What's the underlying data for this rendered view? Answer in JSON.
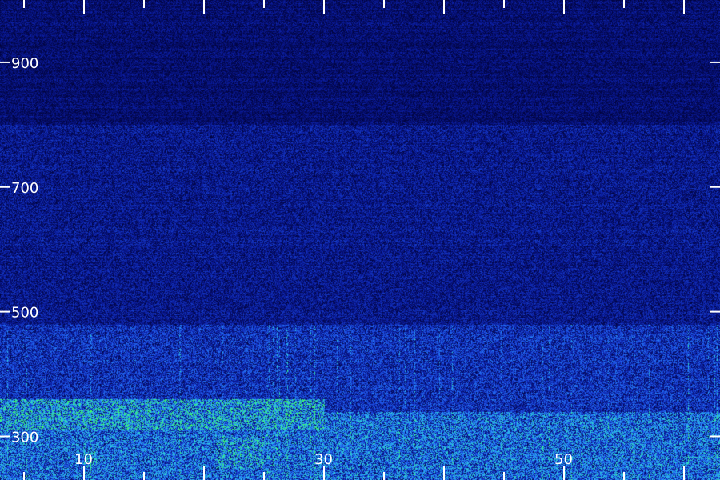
{
  "chart_data": {
    "type": "heatmap",
    "title": "",
    "xlabel": "",
    "ylabel": "",
    "xlim": [
      3,
      63
    ],
    "ylim": [
      230,
      1000
    ],
    "x_ticks": {
      "minor_step": 5,
      "labeled": [
        "10",
        "30",
        "50"
      ],
      "labeled_values": [
        10,
        30,
        50
      ]
    },
    "y_ticks": {
      "values": [
        300,
        500,
        700,
        900
      ],
      "labels": [
        "300",
        "500",
        "700",
        "900"
      ]
    },
    "colormap": [
      "#000030",
      "#0a1a9a",
      "#1e50e6",
      "#2aa0ff",
      "#30e0c0",
      "#40ff60"
    ],
    "grid": false,
    "legend": "none",
    "intensity_bands": [
      {
        "y_from": 230,
        "y_to": 340,
        "level": 0.55
      },
      {
        "y_from": 340,
        "y_to": 480,
        "level": 0.35
      },
      {
        "y_from": 480,
        "y_to": 800,
        "level": 0.22
      },
      {
        "y_from": 800,
        "y_to": 1000,
        "level": 0.15
      }
    ],
    "hotspots": [
      {
        "x_from": 3,
        "x_to": 30,
        "y_from": 310,
        "y_to": 360,
        "level": 0.9
      },
      {
        "x_from": 21,
        "x_to": 25,
        "y_from": 250,
        "y_to": 300,
        "level": 0.85
      },
      {
        "x_from": 10,
        "x_to": 11,
        "y_from": 250,
        "y_to": 280,
        "level": 0.8
      },
      {
        "x_from": 30,
        "x_to": 55,
        "y_from": 300,
        "y_to": 340,
        "level": 0.6
      }
    ]
  }
}
